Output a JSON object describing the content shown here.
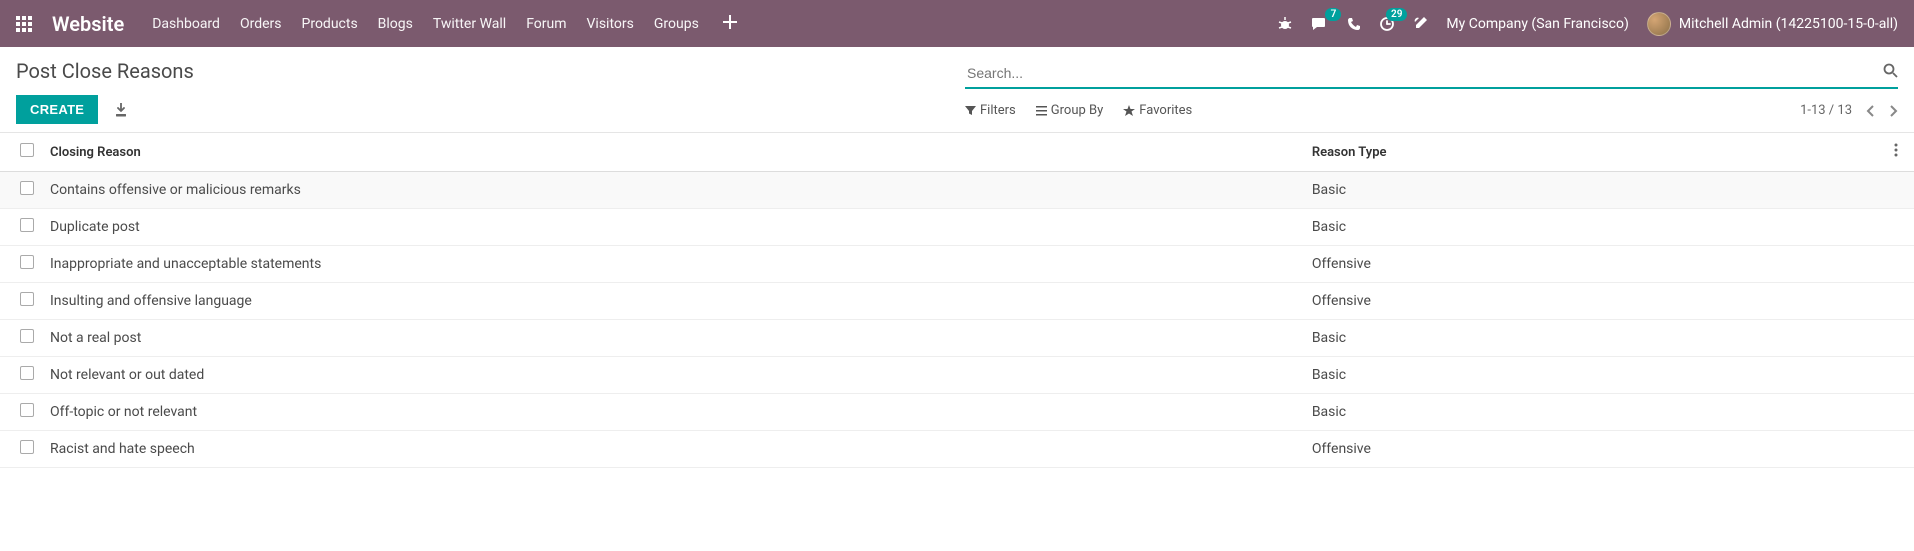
{
  "brand": "Website",
  "nav": {
    "links": [
      "Dashboard",
      "Orders",
      "Products",
      "Blogs",
      "Twitter Wall",
      "Forum",
      "Visitors",
      "Groups"
    ]
  },
  "messages_badge": "7",
  "activities_badge": "29",
  "company": "My Company (San Francisco)",
  "user_name": "Mitchell Admin (14225100-15-0-all)",
  "page_title": "Post Close Reasons",
  "create_label": "CREATE",
  "search_placeholder": "Search...",
  "filters_label": "Filters",
  "groupby_label": "Group By",
  "favorites_label": "Favorites",
  "pager": "1-13 / 13",
  "columns": {
    "reason": "Closing Reason",
    "type": "Reason Type"
  },
  "rows": [
    {
      "reason": "Contains offensive or malicious remarks",
      "type": "Basic"
    },
    {
      "reason": "Duplicate post",
      "type": "Basic"
    },
    {
      "reason": "Inappropriate and unacceptable statements",
      "type": "Offensive"
    },
    {
      "reason": "Insulting and offensive language",
      "type": "Offensive"
    },
    {
      "reason": "Not a real post",
      "type": "Basic"
    },
    {
      "reason": "Not relevant or out dated",
      "type": "Basic"
    },
    {
      "reason": "Off-topic or not relevant",
      "type": "Basic"
    },
    {
      "reason": "Racist and hate speech",
      "type": "Offensive"
    }
  ]
}
